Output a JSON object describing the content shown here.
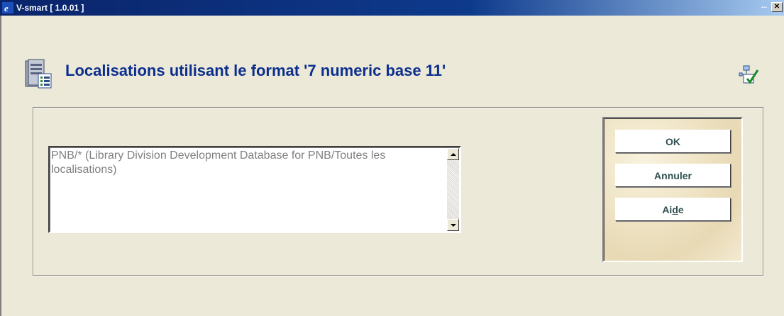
{
  "window": {
    "title": "V-smart [ 1.0.01 ]",
    "minimize_label": "...",
    "close_label": "✕"
  },
  "header": {
    "title": "Localisations utilisant le format '7 numeric base 11'"
  },
  "list": {
    "items": [
      "PNB/* (Library Division Development Database for PNB/Toutes les localisations)"
    ]
  },
  "buttons": {
    "ok": "OK",
    "cancel": "Annuler",
    "help_prefix": "Ai",
    "help_mnemonic": "d",
    "help_suffix": "e"
  },
  "colors": {
    "title_text": "#0c2f8e",
    "titlebar": "#0a246a",
    "background": "#ece9d8",
    "button_text": "#2f4f4f",
    "list_text": "#808080"
  },
  "icons": {
    "app": "ie-icon",
    "header": "database-list-icon",
    "action": "hierarchy-check-icon"
  }
}
